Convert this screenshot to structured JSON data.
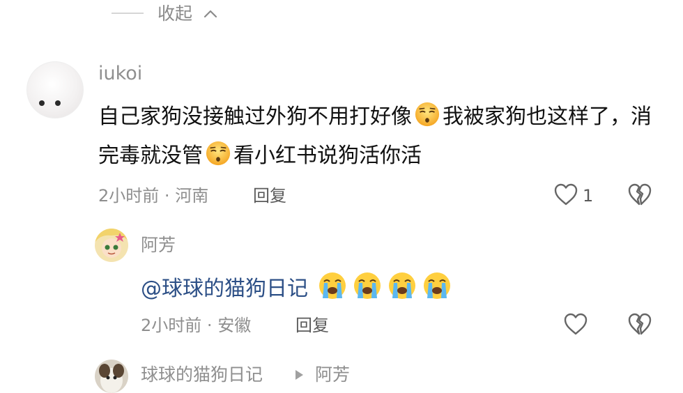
{
  "collapse": {
    "label": "收起"
  },
  "comments": [
    {
      "username": "iukoi",
      "text_part1": "自己家狗没接触过外狗不用打好像",
      "text_part2": "我被家狗也这样了，消完毒就没管",
      "text_part3": "看小红书说狗活你活",
      "emoji": "unamused-face-emoji",
      "time": "2小时前",
      "location": "河南",
      "meta_separator": "·",
      "reply_label": "回复",
      "like_count": "1"
    },
    {
      "username": "阿芳",
      "mention": "@球球的猫狗日记",
      "emoji": "loudly-crying-face-emoji",
      "emoji_count": 4,
      "time": "2小时前",
      "location": "安徽",
      "meta_separator": "·",
      "reply_label": "回复"
    },
    {
      "username": "球球的猫狗日记",
      "reply_to": "阿芳"
    }
  ],
  "colors": {
    "text": "#111111",
    "muted": "#8e8e8e",
    "mention": "#2c4f86",
    "icon": "#666666"
  },
  "icons": [
    "chevron-up-icon",
    "heart-icon",
    "broken-heart-icon",
    "reply-arrow-icon"
  ]
}
